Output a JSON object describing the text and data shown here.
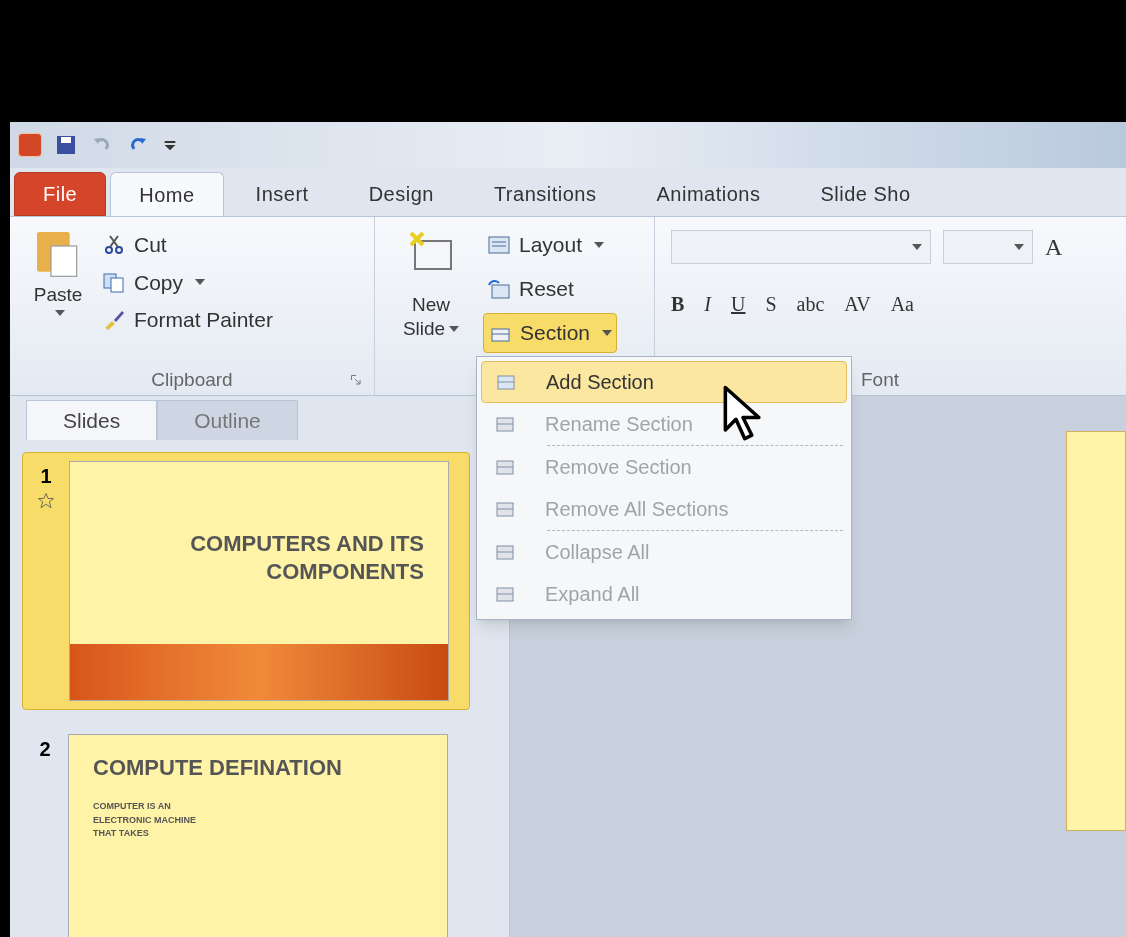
{
  "ribbon_tabs": [
    {
      "label": "File",
      "kind": "file",
      "selected": false
    },
    {
      "label": "Home",
      "kind": "tab",
      "selected": true
    },
    {
      "label": "Insert",
      "kind": "tab",
      "selected": false
    },
    {
      "label": "Design",
      "kind": "tab",
      "selected": false
    },
    {
      "label": "Transitions",
      "kind": "tab",
      "selected": false
    },
    {
      "label": "Animations",
      "kind": "tab",
      "selected": false
    },
    {
      "label": "Slide Sho",
      "kind": "tab",
      "selected": false
    }
  ],
  "clipboard": {
    "paste": "Paste",
    "cut": "Cut",
    "copy": "Copy",
    "format_painter": "Format Painter",
    "group_label": "Clipboard"
  },
  "slides_group": {
    "new_slide_line1": "New",
    "new_slide_line2": "Slide",
    "layout": "Layout",
    "reset": "Reset",
    "section": "Section",
    "section_open": true
  },
  "font_group": {
    "grow_font": "A",
    "buttons": [
      "B",
      "I",
      "U",
      "S",
      "abc",
      "AV",
      "Aa"
    ],
    "group_label": "Font"
  },
  "section_menu": [
    {
      "label": "Add Section",
      "selected": true,
      "disabled": false
    },
    {
      "label": "Rename Section",
      "selected": false,
      "disabled": true
    },
    {
      "label": "Remove Section",
      "selected": false,
      "disabled": true
    },
    {
      "label": "Remove All Sections",
      "selected": false,
      "disabled": true
    },
    {
      "label": "Collapse All",
      "selected": false,
      "disabled": true
    },
    {
      "label": "Expand All",
      "selected": false,
      "disabled": true
    }
  ],
  "panel_tabs": [
    {
      "label": "Slides",
      "selected": true
    },
    {
      "label": "Outline",
      "selected": false
    }
  ],
  "slides": [
    {
      "number": "1",
      "selected": true,
      "title": "COMPUTERS AND ITS COMPONENTS"
    },
    {
      "number": "2",
      "selected": false,
      "title": "COMPUTE  DEFINATION",
      "bullet": "COMPUTER IS AN ELECTRONIC MACHINE THAT TAKES"
    }
  ]
}
